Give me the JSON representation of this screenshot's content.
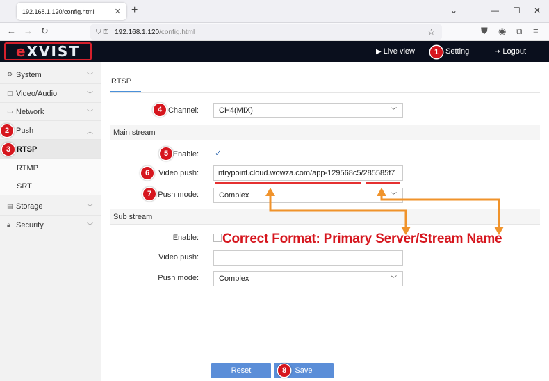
{
  "browser": {
    "tab_title": "192.168.1.120/config.html",
    "url_host": "192.168.1.120",
    "url_path": "/config.html"
  },
  "header": {
    "logo_prefix": "e",
    "logo_main": "XVIST",
    "live_view": "Live view",
    "setting": "Setting",
    "logout": "Logout"
  },
  "sidebar": {
    "items": [
      {
        "label": "System"
      },
      {
        "label": "Video/Audio"
      },
      {
        "label": "Network"
      },
      {
        "label": "Push"
      },
      {
        "label": "RTSP"
      },
      {
        "label": "RTMP"
      },
      {
        "label": "SRT"
      },
      {
        "label": "Storage"
      },
      {
        "label": "Security"
      }
    ]
  },
  "main": {
    "tab": "RTSP",
    "channel_label": "Channel:",
    "channel_value": "CH4(MIX)",
    "main_stream": {
      "title": "Main stream",
      "enable_label": "Enable:",
      "enabled": true,
      "video_push_label": "Video push:",
      "video_push_value": "ntrypoint.cloud.wowza.com/app-129568c5/285585f7",
      "push_mode_label": "Push mode:",
      "push_mode_value": "Complex"
    },
    "sub_stream": {
      "title": "Sub stream",
      "enable_label": "Enable:",
      "enabled": false,
      "video_push_label": "Video push:",
      "video_push_value": "",
      "push_mode_label": "Push mode:",
      "push_mode_value": "Complex"
    },
    "reset_label": "Reset",
    "save_label": "Save"
  },
  "annotations": {
    "badges": [
      "1",
      "2",
      "3",
      "4",
      "5",
      "6",
      "7",
      "8"
    ],
    "callout": "Correct Format: Primary Server/Stream Name",
    "badge_color": "#d6161e",
    "arrow_color": "#f0932b"
  }
}
